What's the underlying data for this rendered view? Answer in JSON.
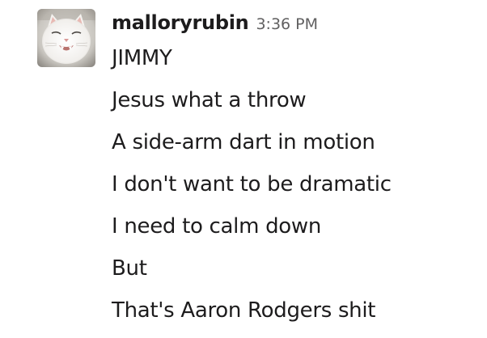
{
  "message": {
    "author": "malloryrubin",
    "timestamp": "3:36 PM",
    "avatar_icon": "cat-avatar",
    "lines": [
      "JIMMY",
      "Jesus what a throw",
      "A side-arm dart in motion",
      "I don't want to be dramatic",
      "I need to calm down",
      "But",
      "That's Aaron Rodgers shit"
    ]
  }
}
